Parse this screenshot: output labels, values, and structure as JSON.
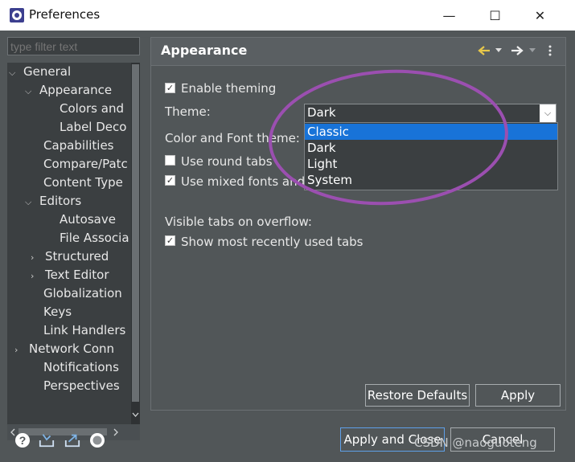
{
  "window": {
    "title": "Preferences",
    "minimize_glyph": "—",
    "maximize_glyph": "☐",
    "close_glyph": "✕"
  },
  "filter": {
    "placeholder": "type filter text"
  },
  "tree": {
    "items": [
      {
        "label": "General",
        "toggle": "⌵"
      },
      {
        "label": "Appearance",
        "toggle": "⌵"
      },
      {
        "label": "Colors and",
        "toggle": ""
      },
      {
        "label": "Label Deco",
        "toggle": ""
      },
      {
        "label": "Capabilities",
        "toggle": ""
      },
      {
        "label": "Compare/Patc",
        "toggle": ""
      },
      {
        "label": "Content Type",
        "toggle": ""
      },
      {
        "label": "Editors",
        "toggle": "⌵"
      },
      {
        "label": "Autosave",
        "toggle": ""
      },
      {
        "label": "File Associa",
        "toggle": ""
      },
      {
        "label": "Structured",
        "toggle": "›"
      },
      {
        "label": "Text Editor",
        "toggle": "›"
      },
      {
        "label": "Globalization",
        "toggle": ""
      },
      {
        "label": "Keys",
        "toggle": ""
      },
      {
        "label": "Link Handlers",
        "toggle": ""
      },
      {
        "label": "Network Conn",
        "toggle": "›"
      },
      {
        "label": "Notifications",
        "toggle": ""
      },
      {
        "label": "Perspectives",
        "toggle": ""
      }
    ]
  },
  "page": {
    "title": "Appearance",
    "enable_theming": {
      "label": "Enable theming",
      "checked": true,
      "mark": "✓"
    },
    "theme_label": "Theme:",
    "theme_value": "Dark",
    "theme_options": [
      "Classic",
      "Dark",
      "Light",
      "System"
    ],
    "theme_selected_option": "Classic",
    "color_font_label": "Color and Font theme:",
    "round_tabs": {
      "label": "Use round tabs",
      "checked": false,
      "mark": ""
    },
    "mixed_fonts": {
      "label": "Use mixed fonts and",
      "checked": true,
      "mark": "✓"
    },
    "visible_tabs_label": "Visible tabs on overflow:",
    "recent_tabs": {
      "label": "Show most recently used tabs",
      "checked": true,
      "mark": "✓"
    },
    "restore_defaults": "Restore Defaults",
    "apply": "Apply"
  },
  "footer": {
    "apply_and_close": "Apply and Close",
    "cancel": "Cancel",
    "watermark": "CSDN @naoguoteng",
    "icons": [
      "help-icon",
      "import-icon",
      "export-icon",
      "record-icon"
    ]
  },
  "colors": {
    "body_bg": "#515658",
    "selection": "#1873d8",
    "annotation_ellipse": "#9b4fb0",
    "nav_arrow": "#e8c84a"
  }
}
